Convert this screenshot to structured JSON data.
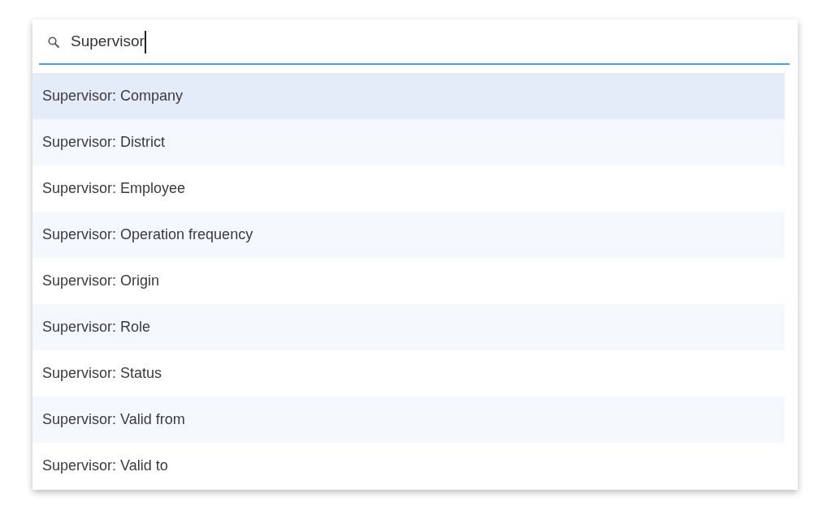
{
  "search": {
    "value": "Supervisor",
    "focused": true
  },
  "results": [
    {
      "label": "Supervisor: Company",
      "selected": true
    },
    {
      "label": "Supervisor: District",
      "selected": false
    },
    {
      "label": "Supervisor: Employee",
      "selected": false
    },
    {
      "label": "Supervisor: Operation frequency",
      "selected": false
    },
    {
      "label": "Supervisor: Origin",
      "selected": false
    },
    {
      "label": "Supervisor: Role",
      "selected": false
    },
    {
      "label": "Supervisor: Status",
      "selected": false
    },
    {
      "label": "Supervisor: Valid from",
      "selected": false
    },
    {
      "label": "Supervisor: Valid to",
      "selected": false
    }
  ]
}
